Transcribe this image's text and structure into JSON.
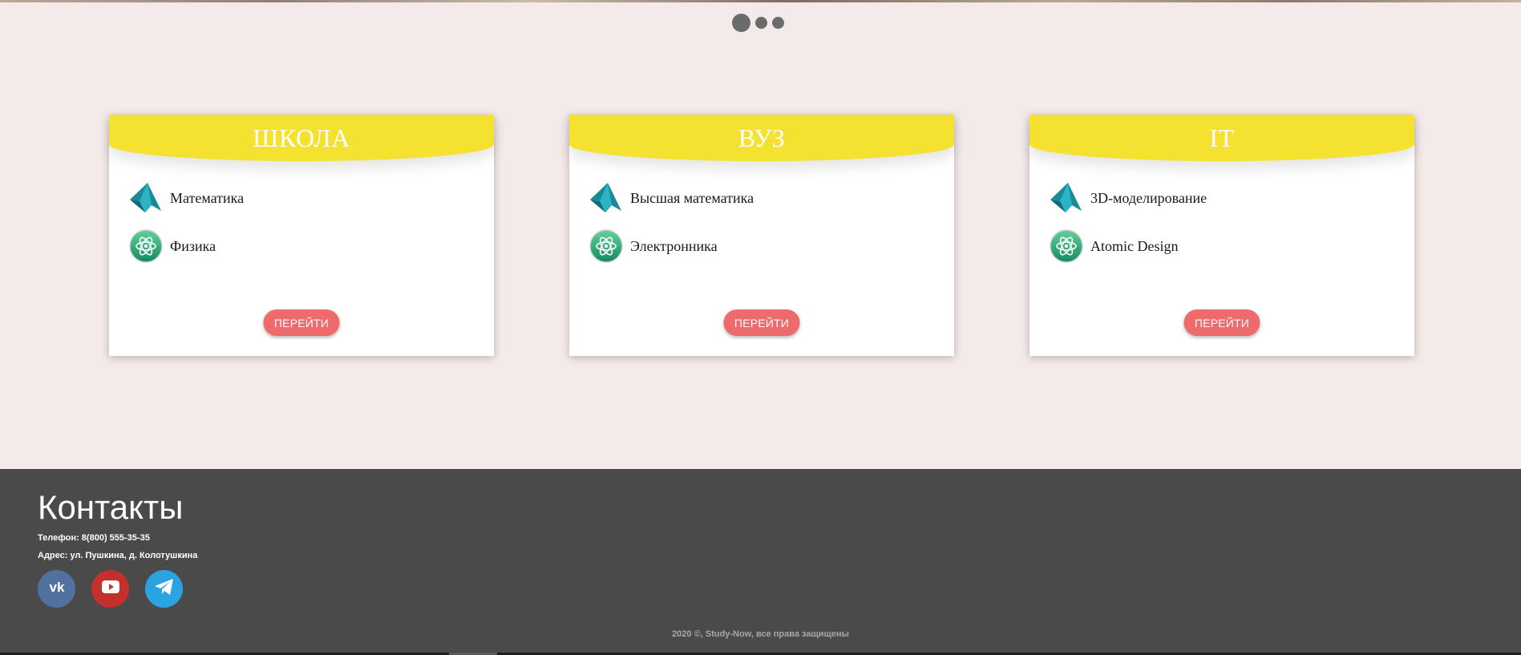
{
  "slider": {
    "dots": 3,
    "active_index": 0
  },
  "cards": [
    {
      "title": "ШКОЛА",
      "subjects": [
        {
          "label": "Математика",
          "icon": "matlab-icon"
        },
        {
          "label": "Физика",
          "icon": "atom-icon"
        }
      ],
      "button_label": "ПЕРЕЙТИ"
    },
    {
      "title": "ВУЗ",
      "subjects": [
        {
          "label": "Высшая математика",
          "icon": "matlab-icon"
        },
        {
          "label": "Электронника",
          "icon": "atom-icon"
        }
      ],
      "button_label": "ПЕРЕЙТИ"
    },
    {
      "title": "IT",
      "subjects": [
        {
          "label": "3D-моделирование",
          "icon": "matlab-icon"
        },
        {
          "label": "Atomic Design",
          "icon": "atom-icon"
        }
      ],
      "button_label": "ПЕРЕЙТИ"
    }
  ],
  "footer": {
    "title": "Контакты",
    "phone": "Телефон: 8(800) 555-35-35",
    "address": "Адрес: ул. Пушкина, д. Колотушкина",
    "socials": [
      {
        "icon": "vk-icon",
        "color": "#50729f"
      },
      {
        "icon": "youtube-icon",
        "color": "#c4302b"
      },
      {
        "icon": "telegram-icon",
        "color": "#2aa3e0"
      }
    ],
    "copyright": "2020 ©, Study-Now, все права защищены"
  },
  "colors": {
    "background": "#f4eaea",
    "card_header": "#f5e12f",
    "button": "#ef6a6a",
    "footer": "#4a4a4a"
  }
}
